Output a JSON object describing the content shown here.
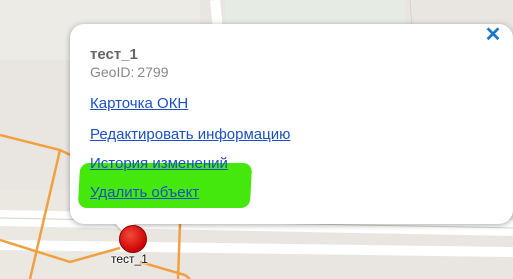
{
  "popup": {
    "title": "тест_1",
    "geoid_label": "GeoID:",
    "geoid_value": "2799",
    "close_icon": "close-icon",
    "links": [
      {
        "label": "Карточка ОКН"
      },
      {
        "label": "Редактировать информацию"
      },
      {
        "label": "История изменений"
      },
      {
        "label": "Удалить объект"
      }
    ]
  },
  "marker": {
    "label": "тест_1",
    "icon": "map-marker-icon"
  },
  "colors": {
    "link": "#1b50c4",
    "close": "#1a74c9",
    "highlight": "#44e80d",
    "marker": "#d00808",
    "road": "#f0a040"
  }
}
